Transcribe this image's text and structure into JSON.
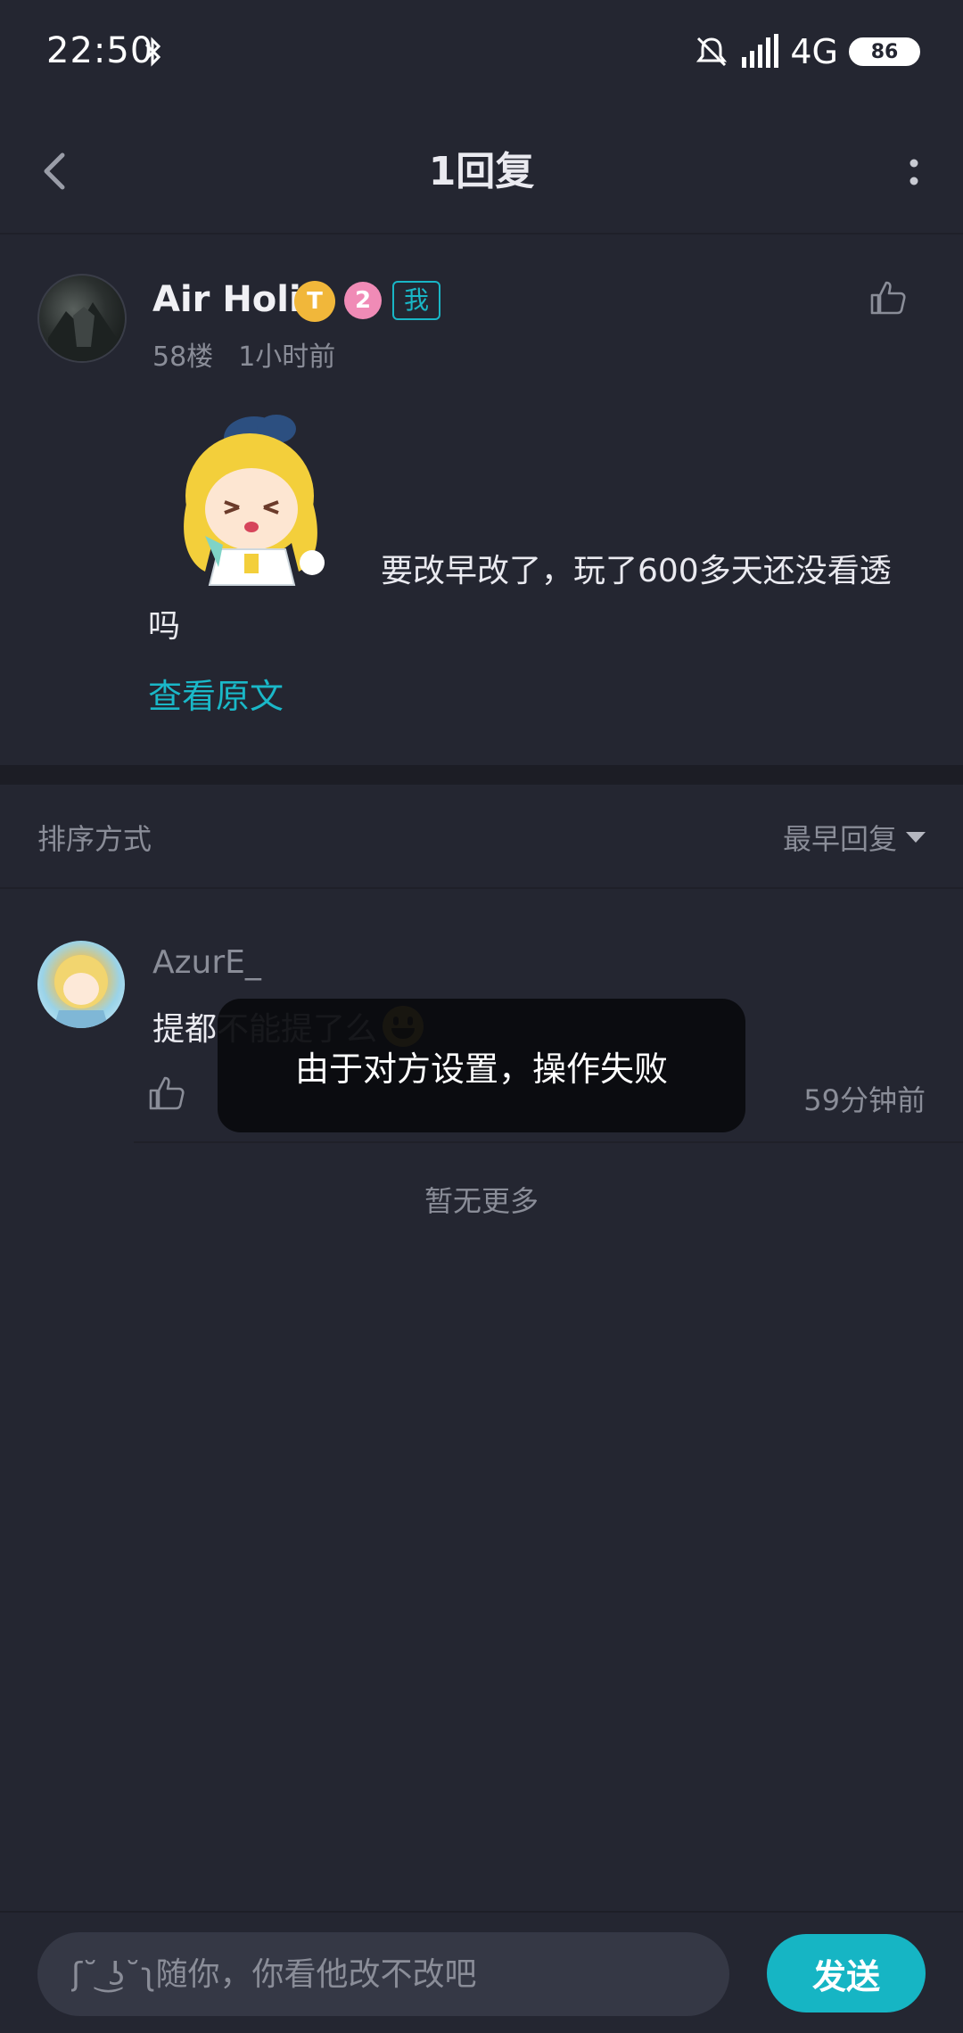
{
  "status_bar": {
    "time": "22:50",
    "network": "4G",
    "battery": "86",
    "icons": [
      "bluetooth-icon",
      "mute-icon",
      "signal-icon",
      "battery-icon"
    ]
  },
  "header": {
    "title": "1回复",
    "icons": [
      "back-arrow-icon",
      "more-vert-icon"
    ]
  },
  "post": {
    "author": "Air Holic",
    "coin_badge": "T",
    "level_badge": "2",
    "me_badge": "我",
    "floor": "58楼",
    "time": "1小时前",
    "text_line1": "要改早改了，玩了600多天还没看透",
    "text_line2": "吗",
    "view_original": "查看原文"
  },
  "sort": {
    "label": "排序方式",
    "selected": "最早回复"
  },
  "reply": {
    "author": "AzurE_",
    "text": "提都不能提了么",
    "time": "59分钟前"
  },
  "no_more": "暂无更多",
  "toast": "由于对方设置，操作失败",
  "composer": {
    "placeholder": "ʃ˘ ͜ʖ˘ʅ随你，你看他改不改吧",
    "send_label": "发送"
  },
  "colors": {
    "background": "#242631",
    "accent": "#16b5c4",
    "muted_text": "#8a8d98",
    "coin": "#f1b73a",
    "level": "#f08bb6"
  }
}
